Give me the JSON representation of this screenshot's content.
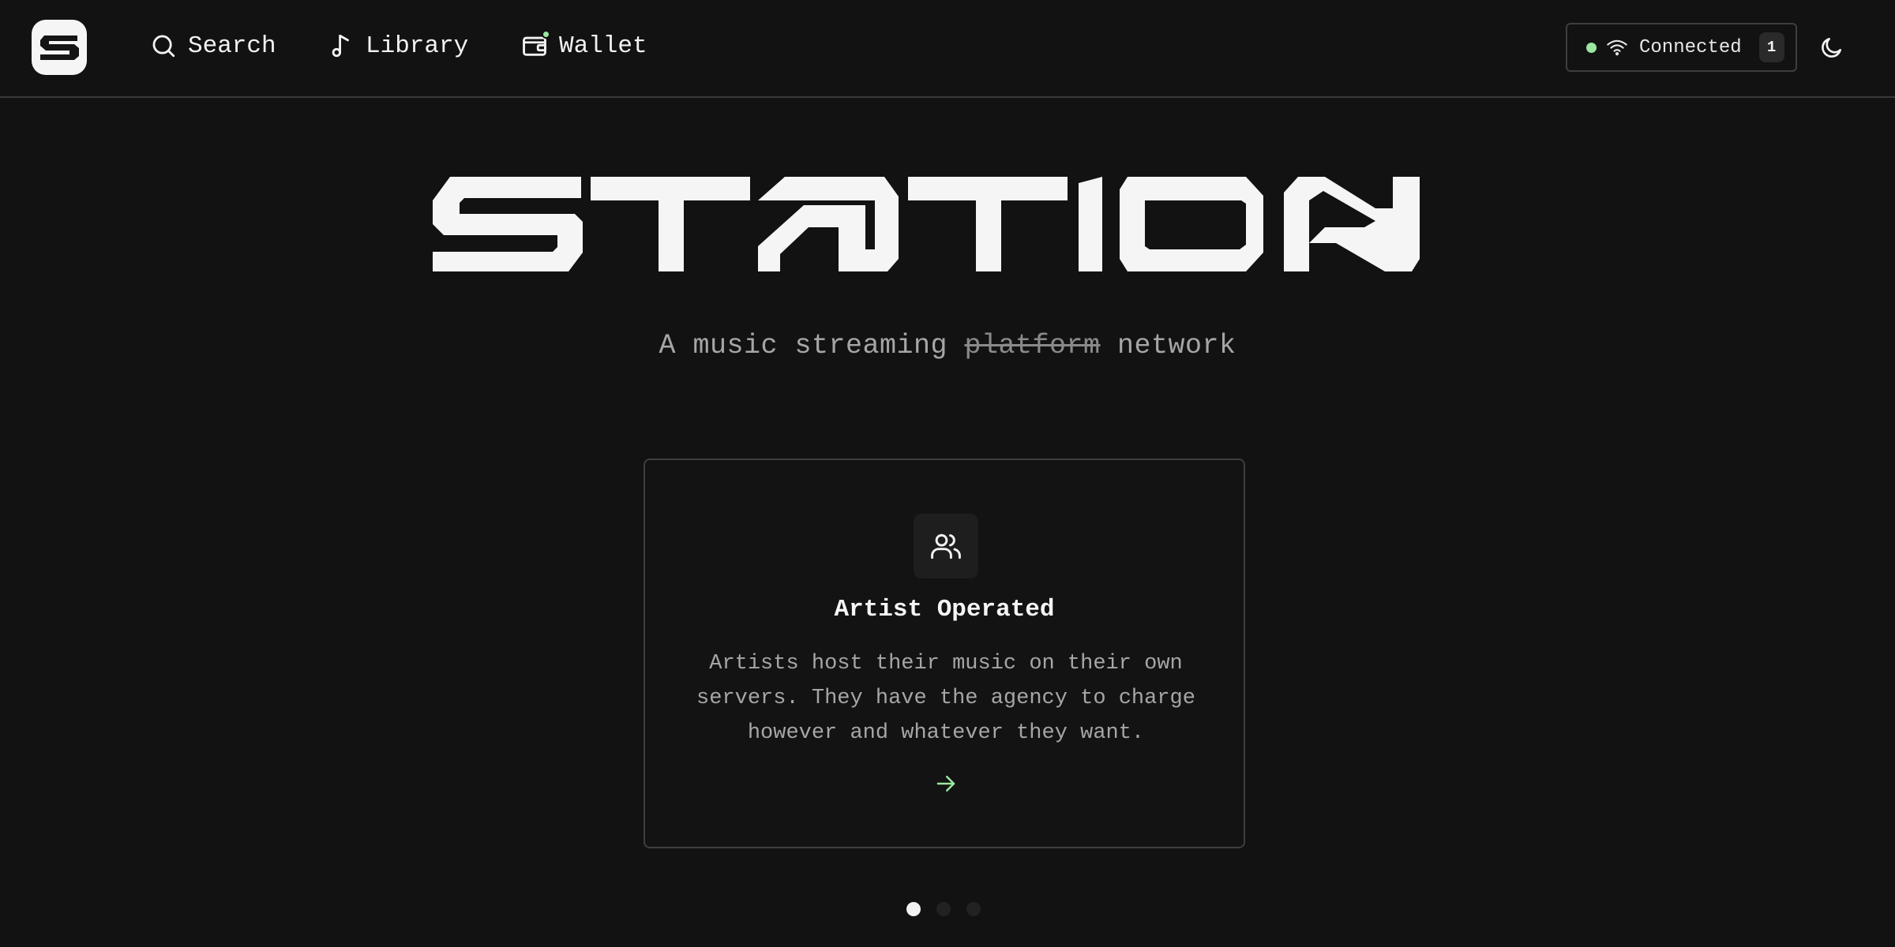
{
  "nav": {
    "logo_label": "S",
    "items": [
      {
        "label": "Search",
        "icon": "search-icon"
      },
      {
        "label": "Library",
        "icon": "music-note-icon"
      },
      {
        "label": "Wallet",
        "icon": "wallet-icon"
      }
    ],
    "status": {
      "label": "Connected",
      "count": "1",
      "icon": "wifi-icon",
      "dot_color": "#9be7a0"
    },
    "theme_toggle_icon": "moon-icon"
  },
  "hero": {
    "wordmark": "STATION",
    "tagline_prefix": "A music streaming ",
    "tagline_struck": "platform",
    "tagline_suffix": " network"
  },
  "feature": {
    "icon": "users-icon",
    "title": "Artist Operated",
    "body": "Artists host their music on their own servers. They have the agency to charge however and whatever they want.",
    "arrow_icon": "arrow-right-icon",
    "accent_color": "#9be7a0"
  },
  "pagination": {
    "total": 3,
    "active_index": 0
  }
}
